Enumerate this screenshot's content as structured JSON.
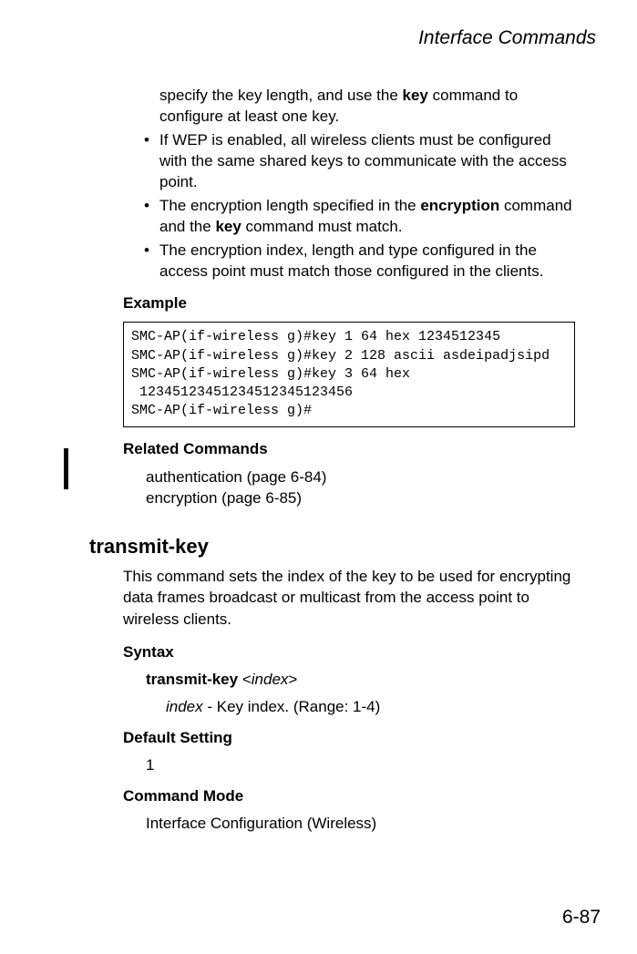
{
  "header": {
    "title": "Interface Commands"
  },
  "intro": {
    "lead_in": "specify the key length, and use the ",
    "key_word": "key",
    "lead_out": " command to configure at least one key."
  },
  "bullets": {
    "b1": "If WEP is enabled, all wireless clients must be configured with the same shared keys to communicate with the access point.",
    "b2_a": "The encryption length specified in the ",
    "b2_enc": "encryption",
    "b2_b": " command and the ",
    "b2_key": "key",
    "b2_c": " command must match.",
    "b3": "The encryption index, length and type configured in the access point must match those configured in the clients."
  },
  "example": {
    "heading": "Example",
    "code": "SMC-AP(if-wireless g)#key 1 64 hex 1234512345\nSMC-AP(if-wireless g)#key 2 128 ascii asdeipadjsipd\nSMC-AP(if-wireless g)#key 3 64 hex\n 12345123451234512345123456\nSMC-AP(if-wireless g)#"
  },
  "related": {
    "heading": "Related Commands",
    "line1": "authentication (page 6-84)",
    "line2": "encryption (page 6-85)"
  },
  "command": {
    "title": "transmit-key",
    "description": "This command sets the index of the key to be used for encrypting data frames broadcast or multicast from the access point to wireless clients."
  },
  "syntax": {
    "heading": "Syntax",
    "cmd": "transmit-key",
    "arg_open": " <",
    "arg": "index",
    "arg_close": ">",
    "param": "index",
    "param_desc": " - Key index. (Range: 1-4)"
  },
  "default": {
    "heading": "Default Setting",
    "value": "1"
  },
  "mode": {
    "heading": "Command Mode",
    "value": "Interface Configuration (Wireless)"
  },
  "footer": {
    "page": "6-87"
  }
}
